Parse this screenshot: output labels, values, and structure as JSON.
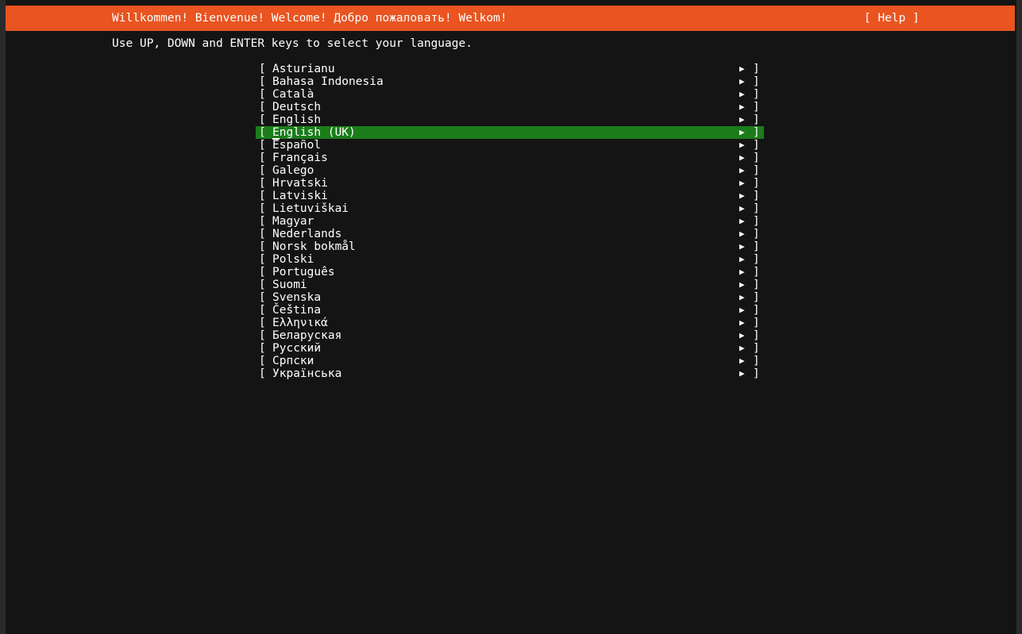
{
  "header": {
    "title": "Willkommen! Bienvenue! Welcome! Добро пожаловать! Welkom!",
    "help_label": "[ Help ]",
    "background_color": "#e95420",
    "text_color": "#ffffff"
  },
  "instruction": {
    "text": "Use UP, DOWN and ENTER keys to select your language."
  },
  "list": {
    "bracket_open": "[",
    "bracket_close": "]",
    "arrow_icon": "▶",
    "selected_index": 5,
    "selected_background_color": "#1a7d1a",
    "items": [
      {
        "label": "Asturianu"
      },
      {
        "label": "Bahasa Indonesia"
      },
      {
        "label": "Català"
      },
      {
        "label": "Deutsch"
      },
      {
        "label": "English"
      },
      {
        "label": "English (UK)"
      },
      {
        "label": "Español"
      },
      {
        "label": "Français"
      },
      {
        "label": "Galego"
      },
      {
        "label": "Hrvatski"
      },
      {
        "label": "Latviski"
      },
      {
        "label": "Lietuviškai"
      },
      {
        "label": "Magyar"
      },
      {
        "label": "Nederlands"
      },
      {
        "label": "Norsk bokmål"
      },
      {
        "label": "Polski"
      },
      {
        "label": "Português"
      },
      {
        "label": "Suomi"
      },
      {
        "label": "Svenska"
      },
      {
        "label": "Čeština"
      },
      {
        "label": "Ελληνικά"
      },
      {
        "label": "Беларуская"
      },
      {
        "label": "Русский"
      },
      {
        "label": "Српски"
      },
      {
        "label": "Українська"
      }
    ]
  },
  "theme": {
    "terminal_background": "#141414",
    "border_background": "#2b2b2b",
    "foreground": "#ffffff"
  }
}
